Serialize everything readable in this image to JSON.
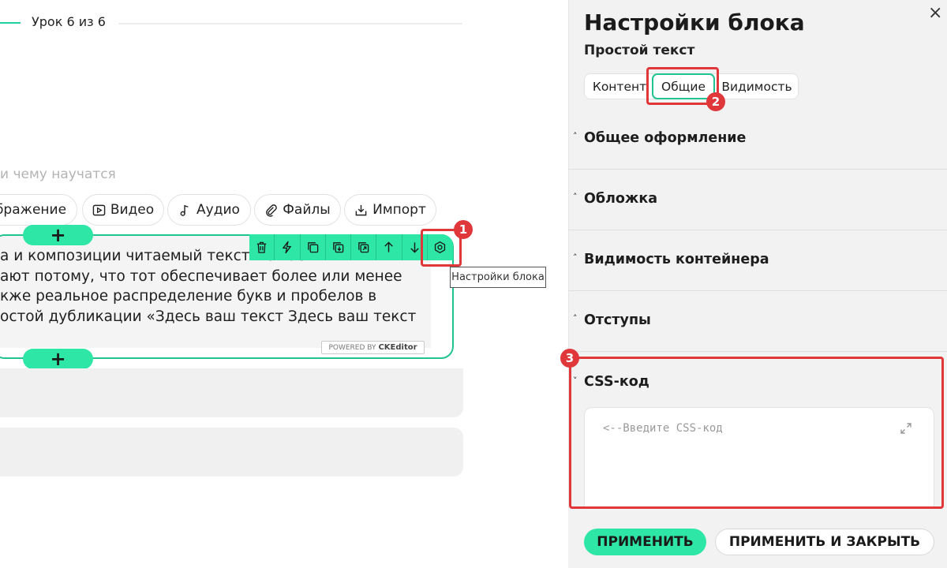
{
  "lesson": {
    "label": "Урок 6 из 6"
  },
  "editor": {
    "placeholder": "и чему научатся",
    "buttons": [
      {
        "label": "бражение",
        "icon": "image-icon"
      },
      {
        "label": "Видео",
        "icon": "video-icon"
      },
      {
        "label": "Аудио",
        "icon": "music-note-icon"
      },
      {
        "label": "Файлы",
        "icon": "paperclip-icon"
      },
      {
        "label": "Импорт",
        "icon": "import-icon"
      }
    ],
    "text_lines": [
      "а и композиции читаемый текст мешает",
      "ают потому, что тот обеспечивает более или менее",
      "кже реальное распределение букв и пробелов в",
      "остой дубликации «Здесь ваш текст Здесь ваш текст"
    ],
    "add_symbol": "+",
    "toolbar_icons": [
      "trash-icon",
      "lightning-icon",
      "copy-icon",
      "download-icon",
      "duplicate-icon",
      "arrow-up-icon",
      "arrow-down-icon",
      "settings-icon"
    ],
    "tooltip": "Настройки блока",
    "ck_badge": {
      "powered": "POWERED BY",
      "brand": "CKEditor"
    }
  },
  "panel": {
    "title": "Настройки блока",
    "subtitle": "Простой текст",
    "tabs": [
      {
        "label": "Контент",
        "active": false
      },
      {
        "label": "Общие",
        "active": true
      },
      {
        "label": "Видимость",
        "active": false
      }
    ],
    "sections": [
      {
        "label": "Общее оформление",
        "chevron": "˄"
      },
      {
        "label": "Обложка",
        "chevron": "˄"
      },
      {
        "label": "Видимость контейнера",
        "chevron": "˄"
      },
      {
        "label": "Отступы",
        "chevron": "˄"
      }
    ],
    "css_section": {
      "label": "CSS-код",
      "chevron": "˅",
      "placeholder": "<--Введите CSS-код"
    },
    "close": "×",
    "apply": "ПРИМЕНИТЬ",
    "apply_close": "ПРИМЕНИТЬ И ЗАКРЫТЬ"
  },
  "annotations": [
    "1",
    "2",
    "3"
  ],
  "colors": {
    "accent": "#2ee6a6",
    "accent_border": "#21c491",
    "marker": "#e0373b"
  }
}
